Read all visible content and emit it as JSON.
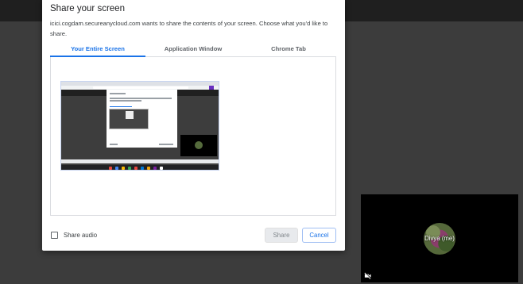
{
  "dialog": {
    "title": "Share your screen",
    "description": "icici.cogdam.secureanycloud.com wants to share the contents of your screen. Choose what you'd like to share.",
    "tabs": [
      {
        "label": "Your Entire Screen",
        "selected": true
      },
      {
        "label": "Application Window",
        "selected": false
      },
      {
        "label": "Chrome Tab",
        "selected": false
      }
    ],
    "share_audio_label": "Share audio",
    "share_audio_checked": false,
    "share_button": "Share",
    "cancel_button": "Cancel"
  },
  "video_tile": {
    "name": "Divya (me)"
  },
  "colors": {
    "accent": "#1a73e8",
    "backdrop": "#3c3c3c",
    "disabled_button": "#e8eaed"
  }
}
